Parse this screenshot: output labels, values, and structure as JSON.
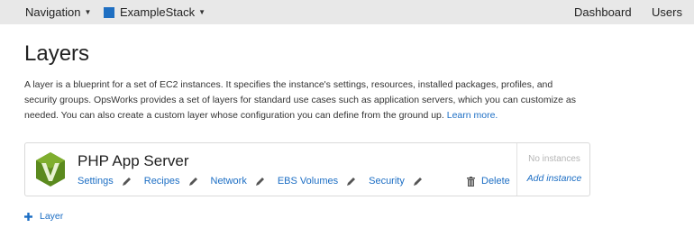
{
  "nav": {
    "navigation_label": "Navigation",
    "stack_label": "ExampleStack",
    "stack_color": "#1f6fc2",
    "dashboard_label": "Dashboard",
    "users_label": "Users",
    "caret_icon": "caret-down-icon"
  },
  "page": {
    "title": "Layers",
    "description": "A layer is a blueprint for a set of EC2 instances. It specifies the instance's settings, resources, installed packages, profiles, and security groups. OpsWorks provides a set of layers for standard use cases such as application servers, which you can customize as needed. You can also create a custom layer whose configuration you can define from the ground up.",
    "learn_more": "Learn more."
  },
  "layer": {
    "name": "PHP App Server",
    "logo_icon": "php-layer-logo-icon",
    "logo_color": "#5b8a1e",
    "links": [
      "Settings",
      "Recipes",
      "Network",
      "EBS Volumes",
      "Security"
    ],
    "edit_icon": "pencil-icon",
    "delete_label": "Delete",
    "delete_icon": "trash-icon",
    "instances_status": "No instances",
    "add_instance": "Add instance"
  },
  "add_layer": {
    "label": "Layer",
    "icon": "plus-icon"
  },
  "colors": {
    "link": "#1c6ec4",
    "nav_bg": "#e8e8e8"
  }
}
